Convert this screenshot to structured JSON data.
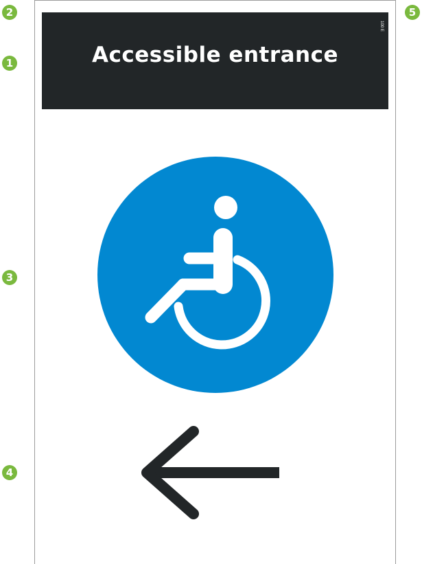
{
  "callouts": {
    "c1": "1",
    "c2": "2",
    "c3": "3",
    "c4": "4",
    "c5": "5"
  },
  "sign": {
    "title": "Accessible entrance",
    "code": "100 E",
    "pictogram": "wheelchair-accessibility-icon",
    "direction": "arrow-left-icon"
  },
  "colors": {
    "callout": "#7ab93e",
    "header_bg": "#222628",
    "header_text": "#ffffff",
    "pictogram_bg": "#0288d1",
    "pictogram_fg": "#ffffff",
    "arrow": "#222628",
    "frame": "#9a9a9a"
  }
}
